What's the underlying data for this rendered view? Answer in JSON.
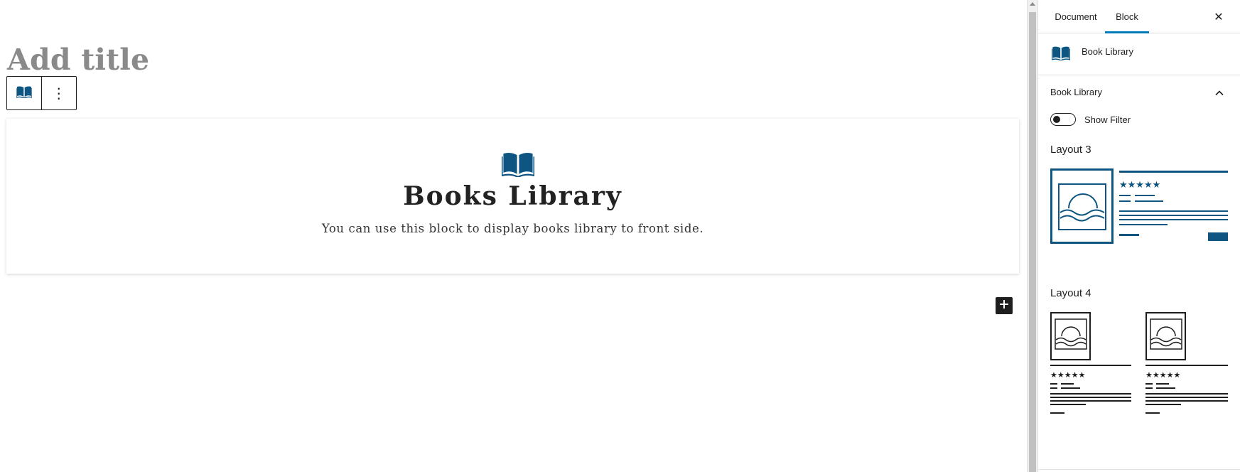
{
  "editor": {
    "title_placeholder": "Add title",
    "toolbar": {
      "block_icon": "book-icon",
      "options_icon": "kebab-menu-icon",
      "options_glyph": "⋮"
    },
    "block": {
      "icon": "book-icon",
      "title": "Books Library",
      "description": "You can use this block to display books library to front side."
    },
    "inserter": {
      "icon": "plus-icon",
      "glyph": "+"
    }
  },
  "sidebar": {
    "tabs": [
      {
        "label": "Document",
        "active": false
      },
      {
        "label": "Block",
        "active": true
      }
    ],
    "close_glyph": "✕",
    "block_card": {
      "icon": "book-icon",
      "title": "Book Library"
    },
    "panel": {
      "title": "Book Library",
      "expanded": true,
      "toggle": {
        "label": "Show Filter",
        "checked": false
      },
      "layouts": [
        {
          "label": "Layout 3",
          "icon": "layout-3-preview-icon",
          "selected": true
        },
        {
          "label": "Layout 4",
          "icon": "layout-4-preview-icon",
          "selected": false
        }
      ]
    }
  },
  "colors": {
    "accent": "#007cba",
    "brand_blue": "#0e5582",
    "dark": "#1e1e1e",
    "placeholder_gray": "#8a8a8a"
  }
}
